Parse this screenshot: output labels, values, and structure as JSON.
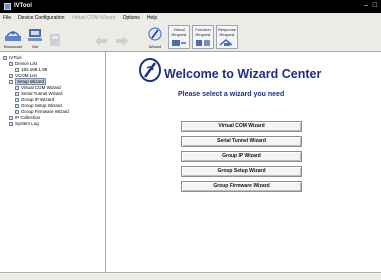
{
  "window": {
    "title": "IVTool"
  },
  "menu": {
    "items": [
      "File",
      "Device Configuration",
      "Virtual COM Wizard",
      "Options",
      "Help"
    ]
  },
  "toolbar": {
    "buttons": [
      {
        "label": "Broadcast",
        "icon": "broadcast-icon"
      },
      {
        "label": "Get",
        "icon": "get-device-icon"
      },
      {
        "label": "",
        "icon": "disabled-icon"
      },
      {
        "label": "",
        "icon": "arrows-disabled-icon"
      },
      {
        "label": "",
        "icon": "arrows-disabled-icon"
      },
      {
        "label": "Wizard",
        "icon": "wizard-icon"
      },
      {
        "label": "Virtual Request",
        "icon": "virtual-request-icon"
      },
      {
        "label": "Function Request",
        "icon": "function-request-icon"
      },
      {
        "label": "Response Request",
        "icon": "response-request-icon"
      }
    ]
  },
  "tree": {
    "items": [
      {
        "label": "IVTool"
      },
      {
        "label": "Device List"
      },
      {
        "label": "192.168.1.99"
      },
      {
        "label": "VCOM List"
      },
      {
        "label": "Setup Wizard"
      },
      {
        "label": "Virtual COM Wizard"
      },
      {
        "label": "Serial Tunnel Wizard"
      },
      {
        "label": "Group IP Wizard"
      },
      {
        "label": "Group Setup Wizard"
      },
      {
        "label": "Group Firmware Wizard"
      },
      {
        "label": "IP Collection"
      },
      {
        "label": "System Log"
      }
    ]
  },
  "main": {
    "heading": "Welcome to Wizard Center",
    "subheading": "Please select a wizard you need",
    "buttons": [
      "Virtual COM Wizard",
      "Serial Tunnel Wizard",
      "Group IP Wizard",
      "Group Setup Wizard",
      "Group Firmware Wizard"
    ]
  },
  "colors": {
    "heading": "#1d2f86",
    "titlebar": "#000000",
    "accent": "#2f6bd6"
  }
}
